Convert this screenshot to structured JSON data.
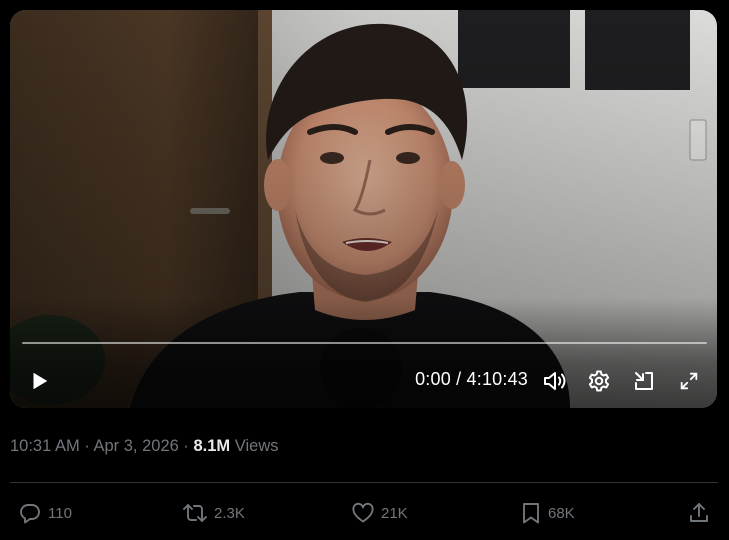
{
  "video": {
    "time_current": "0:00",
    "time_separator": "/",
    "time_total": "4:10:43",
    "progress_fraction": 0,
    "icons": {
      "play": "play-icon",
      "volume": "volume-icon",
      "settings": "gear-icon",
      "minimize": "minimize-icon",
      "fullscreen": "fullscreen-icon"
    }
  },
  "post_meta": {
    "time": "10:31 AM",
    "date": "Apr 3, 2026",
    "views_count": "8.1M",
    "views_label": "Views"
  },
  "actions": {
    "reply": {
      "count": "110",
      "icon": "reply-icon"
    },
    "repost": {
      "count": "2.3K",
      "icon": "repost-icon"
    },
    "like": {
      "count": "21K",
      "icon": "heart-icon"
    },
    "bookmark": {
      "count": "68K",
      "icon": "bookmark-icon"
    },
    "share": {
      "icon": "share-icon"
    }
  },
  "colors": {
    "background": "#000000",
    "text_secondary": "#71767b",
    "text_primary": "#e7e9ea",
    "divider": "#2f3336"
  }
}
